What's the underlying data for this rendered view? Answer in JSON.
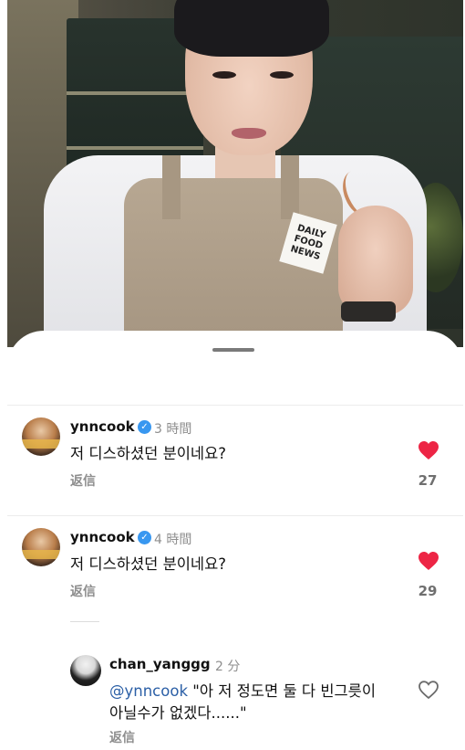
{
  "video": {
    "badge_text": "DAILY FOOD NEWS"
  },
  "comments": [
    {
      "username": "ynncook",
      "time": "3 時間",
      "text": "저 디스하셨던 분이네요?",
      "reply_label": "返信",
      "likes": "27",
      "liked": true
    },
    {
      "username": "ynncook",
      "time": "4 時間",
      "text": "저 디스하셨던 분이네요?",
      "reply_label": "返信",
      "likes": "29",
      "liked": true
    }
  ],
  "reply": {
    "username": "chan_yanggg",
    "time": "2 分",
    "mention": "@ynncook",
    "text_line1": " \"아 저 정도면 둘 다 빈그릇이",
    "text_line2": "아닐수가 없겠다......\"",
    "reply_label": "返信",
    "liked": false
  },
  "colors": {
    "heart_active": "#ed2545",
    "verified": "#3897f0",
    "mention": "#2b5fa6",
    "secondary_text": "#8e8e8e"
  }
}
